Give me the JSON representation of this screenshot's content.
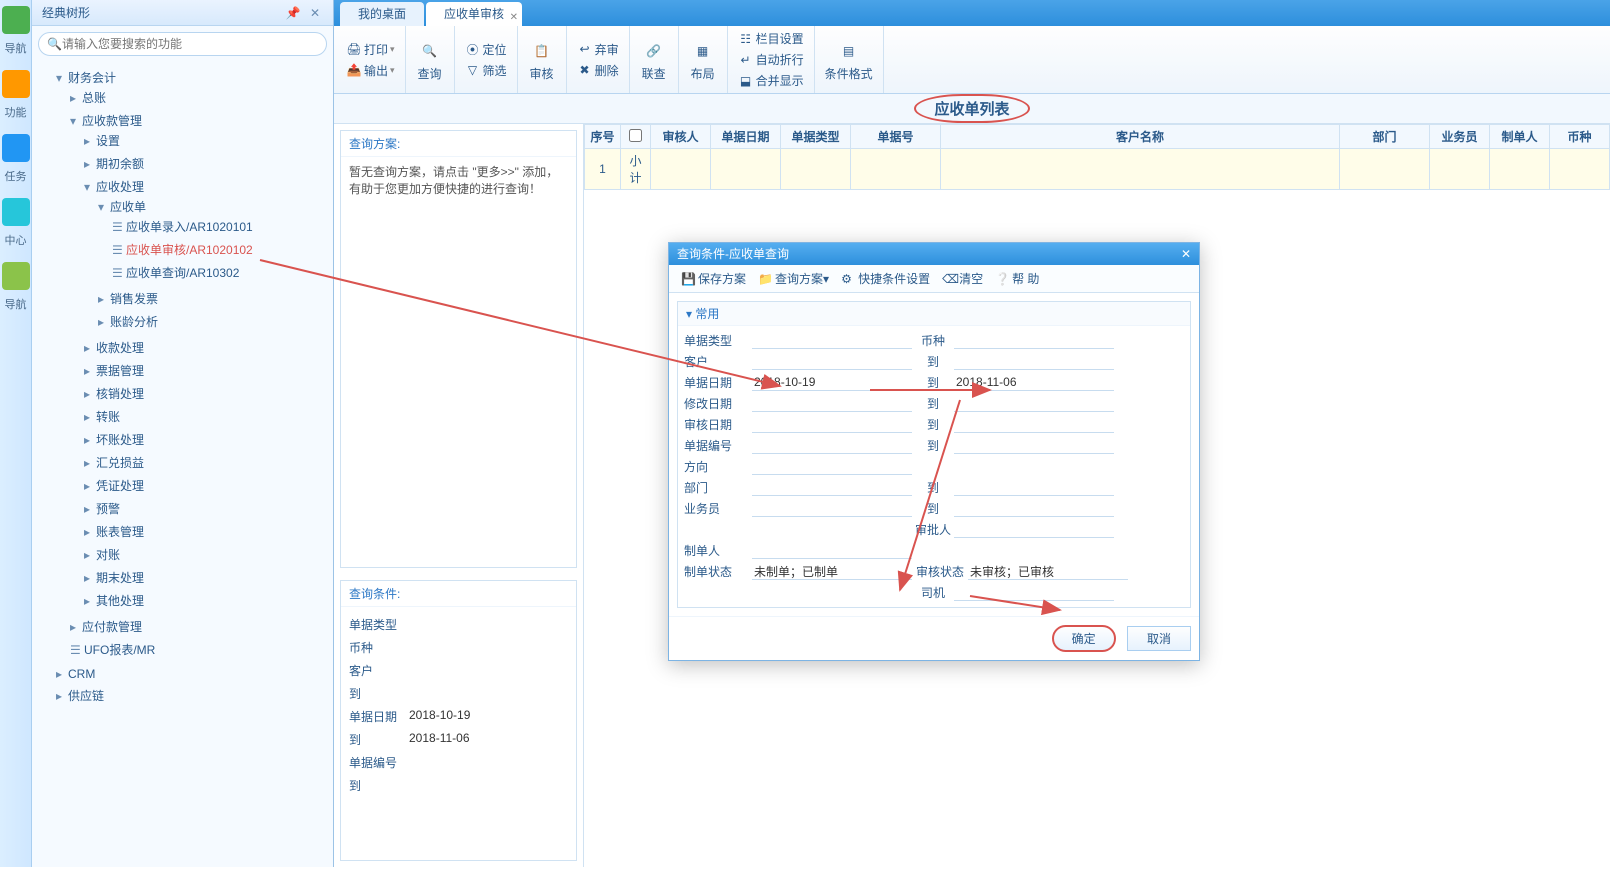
{
  "vstrip": [
    "导航",
    "功能",
    "任务",
    "中心",
    "导航"
  ],
  "sidebar": {
    "title": "经典树形",
    "search_placeholder": "请输入您要搜索的功能",
    "tree": {
      "root": "财务会计",
      "n1": "总账",
      "n2": "应收款管理",
      "n2_1": "设置",
      "n2_2": "期初余额",
      "n2_3": "应收处理",
      "n2_3_1": "应收单",
      "n2_3_1a": "应收单录入/AR1020101",
      "n2_3_1b": "应收单审核/AR1020102",
      "n2_3_1c": "应收单查询/AR10302",
      "n2_3_2": "销售发票",
      "n2_3_3": "账龄分析",
      "n2_4": "收款处理",
      "n2_5": "票据管理",
      "n2_6": "核销处理",
      "n2_7": "转账",
      "n2_8": "坏账处理",
      "n2_9": "汇兑损益",
      "n2_10": "凭证处理",
      "n2_11": "预警",
      "n2_12": "账表管理",
      "n2_13": "对账",
      "n2_14": "期末处理",
      "n2_15": "其他处理",
      "n3": "应付款管理",
      "n4": "UFO报表/MR",
      "n5": "CRM",
      "n6": "供应链"
    }
  },
  "tabs": {
    "t1": "我的桌面",
    "t2": "应收单审核"
  },
  "ribbon": {
    "print": "打印",
    "output": "输出",
    "locate": "定位",
    "query": "查询",
    "filter": "筛选",
    "audit": "审核",
    "abandon": "弃审",
    "delete": "删除",
    "relate": "联查",
    "layout": "布局",
    "colset": "栏目设置",
    "autowrap": "自动折行",
    "merge": "合并显示",
    "condfmt": "条件格式"
  },
  "page_title": "应收单列表",
  "query_panel": {
    "scheme_head": "查询方案:",
    "scheme_hint": "暂无查询方案，请点击 \"更多>>\" 添加，有助于您更加方便快捷的进行查询！",
    "cond_head": "查询条件:",
    "rows": {
      "r1": "单据类型",
      "r2": "币种",
      "r3": "客户",
      "r4": "到",
      "r5": "单据日期",
      "r5v": "2018-10-19",
      "r6": "到",
      "r6v": "2018-11-06",
      "r7": "单据编号",
      "r8": "到"
    }
  },
  "grid": {
    "headers": [
      "序号",
      "",
      "审核人",
      "单据日期",
      "单据类型",
      "单据号",
      "客户名称",
      "部门",
      "业务员",
      "制单人",
      "币种"
    ],
    "subtotal_seq": "1",
    "subtotal_label": "小计"
  },
  "dialog": {
    "title": "查询条件-应收单查询",
    "toolbar": {
      "save": "保存方案",
      "scheme": "查询方案",
      "quick": "快捷条件设置",
      "clear": "清空",
      "help": "帮 助"
    },
    "section": "常用",
    "labels": {
      "doctype": "单据类型",
      "currency": "币种",
      "to": "到",
      "docdate": "单据日期",
      "moddate": "修改日期",
      "auditdate": "审核日期",
      "docno": "单据编号",
      "direction": "方向",
      "dept": "部门",
      "sales": "业务员",
      "approver": "审批人",
      "maker": "制单人",
      "makestate": "制单状态",
      "auditstate": "审核状态",
      "driver": "司机",
      "customer": "客户"
    },
    "values": {
      "docdate_from": "2018-10-19",
      "docdate_to": "2018-11-06",
      "makestate": "未制单；已制单",
      "auditstate": "未审核；已审核"
    },
    "ok": "确定",
    "cancel": "取消"
  }
}
